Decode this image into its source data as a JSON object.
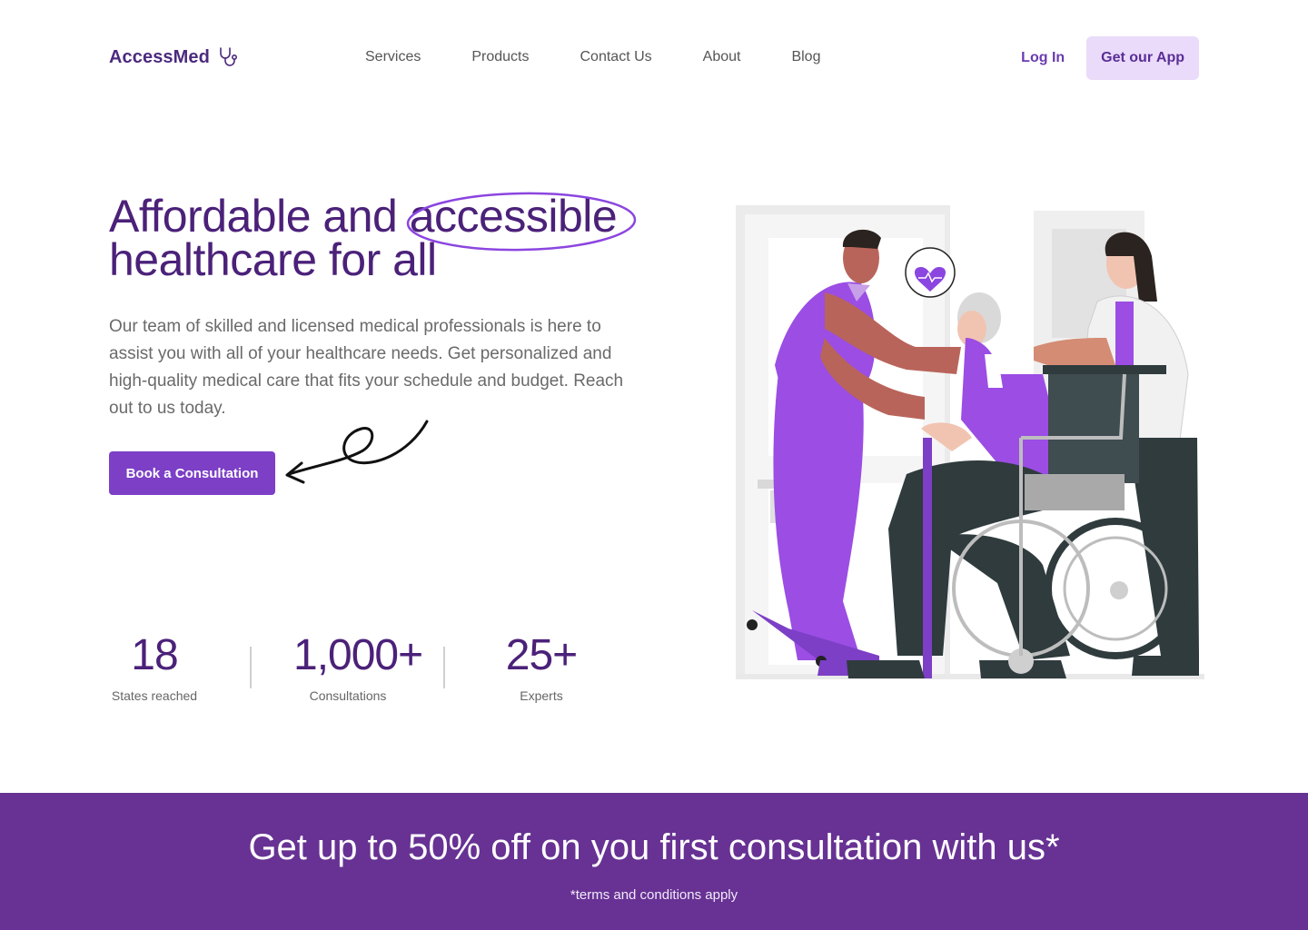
{
  "brand": {
    "name": "AccessMed",
    "icon": "stethoscope-icon"
  },
  "nav": {
    "links": [
      "Services",
      "Products",
      "Contact Us",
      "About",
      "Blog"
    ],
    "login_label": "Log In",
    "get_app_label": "Get our App"
  },
  "hero": {
    "title_before": "Affordable and ",
    "title_highlight": "accessible",
    "title_after": "healthcare for all",
    "description": "Our team of skilled and licensed medical professionals is here to assist you with all of your healthcare needs. Get personalized and high-quality medical care that fits your schedule and budget. Reach out to us today.",
    "cta_label": "Book a Consultation"
  },
  "stats": [
    {
      "value": "18",
      "label": "States reached"
    },
    {
      "value": "1,000+",
      "label": "Consultations"
    },
    {
      "value": "25+",
      "label": "Experts"
    }
  ],
  "banner": {
    "title": "Get up to 50% off on you first consultation with us*",
    "note": "*terms and conditions apply"
  },
  "colors": {
    "primary": "#7c3fc6",
    "dark_purple": "#4b2179",
    "banner": "#673293",
    "light_purple": "#eadbfa"
  }
}
